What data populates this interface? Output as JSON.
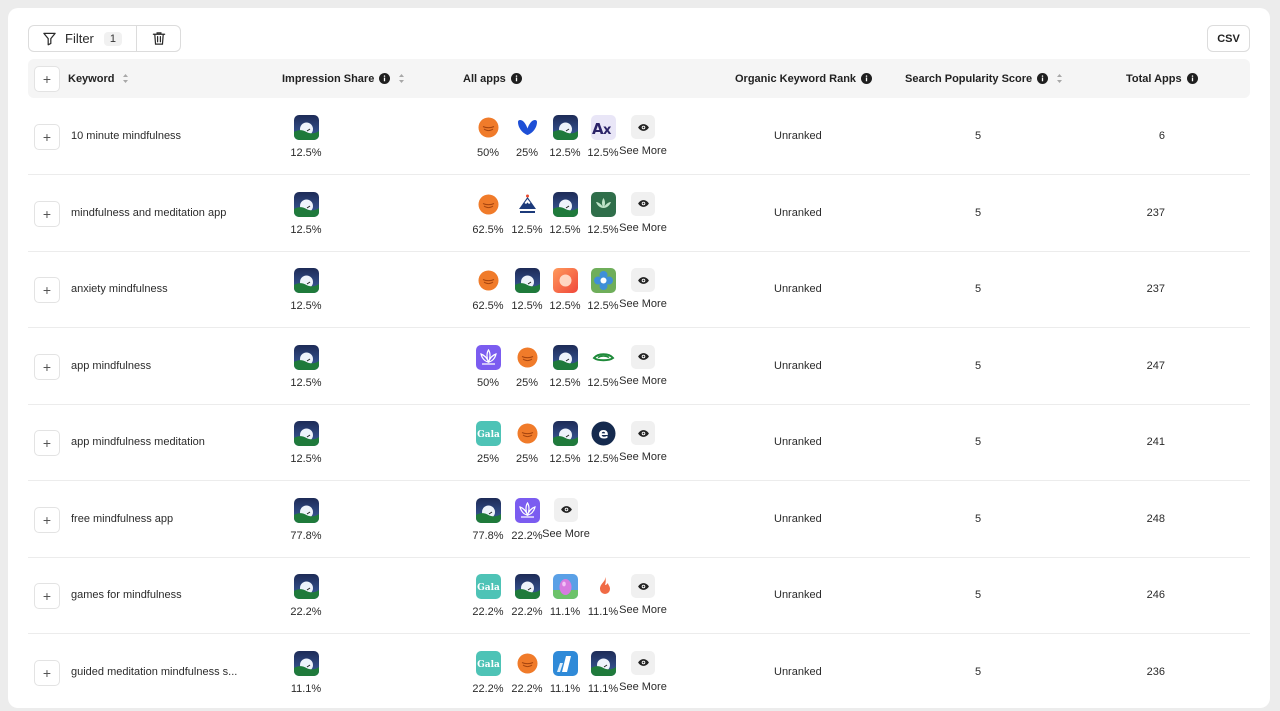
{
  "toolbar": {
    "filter_label": "Filter",
    "filter_count": "1",
    "csv_label": "CSV"
  },
  "columns": {
    "keyword": "Keyword",
    "impression_share": "Impression Share",
    "all_apps": "All apps",
    "organic_rank": "Organic Keyword Rank",
    "popularity": "Search Popularity Score",
    "total_apps": "Total Apps"
  },
  "see_more_label": "See More",
  "rows": [
    {
      "keyword": "10 minute mindfulness",
      "impression": {
        "icon": "moon-landscape-icon",
        "pct": "12.5%"
      },
      "apps": [
        {
          "icon": "orange-face-icon",
          "pct": "50%"
        },
        {
          "icon": "blue-butterfly-icon",
          "pct": "25%"
        },
        {
          "icon": "moon-landscape-icon",
          "pct": "12.5%"
        },
        {
          "icon": "ax-letter-icon",
          "pct": "12.5%"
        }
      ],
      "see_more": true,
      "rank": "Unranked",
      "popularity": "5",
      "total": "6"
    },
    {
      "keyword": "mindfulness and meditation app",
      "impression": {
        "icon": "moon-landscape-icon",
        "pct": "12.5%"
      },
      "apps": [
        {
          "icon": "orange-face-icon",
          "pct": "62.5%"
        },
        {
          "icon": "mountain-logo-icon",
          "pct": "12.5%"
        },
        {
          "icon": "moon-landscape-icon",
          "pct": "12.5%"
        },
        {
          "icon": "lotus-green-icon",
          "pct": "12.5%"
        }
      ],
      "see_more": true,
      "rank": "Unranked",
      "popularity": "5",
      "total": "237"
    },
    {
      "keyword": "anxiety mindfulness",
      "impression": {
        "icon": "moon-landscape-icon",
        "pct": "12.5%"
      },
      "apps": [
        {
          "icon": "orange-face-icon",
          "pct": "62.5%"
        },
        {
          "icon": "moon-landscape-icon",
          "pct": "12.5%"
        },
        {
          "icon": "orange-circle-icon",
          "pct": "12.5%"
        },
        {
          "icon": "blue-flower-icon",
          "pct": "12.5%"
        }
      ],
      "see_more": true,
      "rank": "Unranked",
      "popularity": "5",
      "total": "237"
    },
    {
      "keyword": "app mindfulness",
      "impression": {
        "icon": "moon-landscape-icon",
        "pct": "12.5%"
      },
      "apps": [
        {
          "icon": "purple-lotus-icon",
          "pct": "50%"
        },
        {
          "icon": "orange-face-icon",
          "pct": "25%"
        },
        {
          "icon": "moon-landscape-icon",
          "pct": "12.5%"
        },
        {
          "icon": "green-eye-icon",
          "pct": "12.5%"
        }
      ],
      "see_more": true,
      "rank": "Unranked",
      "popularity": "5",
      "total": "247"
    },
    {
      "keyword": "app mindfulness meditation",
      "impression": {
        "icon": "moon-landscape-icon",
        "pct": "12.5%"
      },
      "apps": [
        {
          "icon": "gala-icon",
          "pct": "25%"
        },
        {
          "icon": "orange-face-icon",
          "pct": "25%"
        },
        {
          "icon": "moon-landscape-icon",
          "pct": "12.5%"
        },
        {
          "icon": "e-letter-icon",
          "pct": "12.5%"
        }
      ],
      "see_more": true,
      "rank": "Unranked",
      "popularity": "5",
      "total": "241"
    },
    {
      "keyword": "free mindfulness app",
      "impression": {
        "icon": "moon-landscape-icon",
        "pct": "77.8%"
      },
      "apps": [
        {
          "icon": "moon-landscape-icon",
          "pct": "77.8%"
        },
        {
          "icon": "purple-lotus-icon",
          "pct": "22.2%"
        }
      ],
      "see_more": true,
      "rank": "Unranked",
      "popularity": "5",
      "total": "248"
    },
    {
      "keyword": "games for mindfulness",
      "impression": {
        "icon": "moon-landscape-icon",
        "pct": "22.2%"
      },
      "apps": [
        {
          "icon": "gala-icon",
          "pct": "22.2%"
        },
        {
          "icon": "moon-landscape-icon",
          "pct": "22.2%"
        },
        {
          "icon": "pink-egg-icon",
          "pct": "11.1%"
        },
        {
          "icon": "flame-icon",
          "pct": "11.1%"
        }
      ],
      "see_more": true,
      "rank": "Unranked",
      "popularity": "5",
      "total": "246"
    },
    {
      "keyword": "guided meditation mindfulness s...",
      "impression": {
        "icon": "moon-landscape-icon",
        "pct": "11.1%"
      },
      "apps": [
        {
          "icon": "gala-icon",
          "pct": "22.2%"
        },
        {
          "icon": "orange-face-icon",
          "pct": "22.2%"
        },
        {
          "icon": "blue-slash-icon",
          "pct": "11.1%"
        },
        {
          "icon": "moon-landscape-icon",
          "pct": "11.1%"
        }
      ],
      "see_more": true,
      "rank": "Unranked",
      "popularity": "5",
      "total": "236"
    }
  ]
}
